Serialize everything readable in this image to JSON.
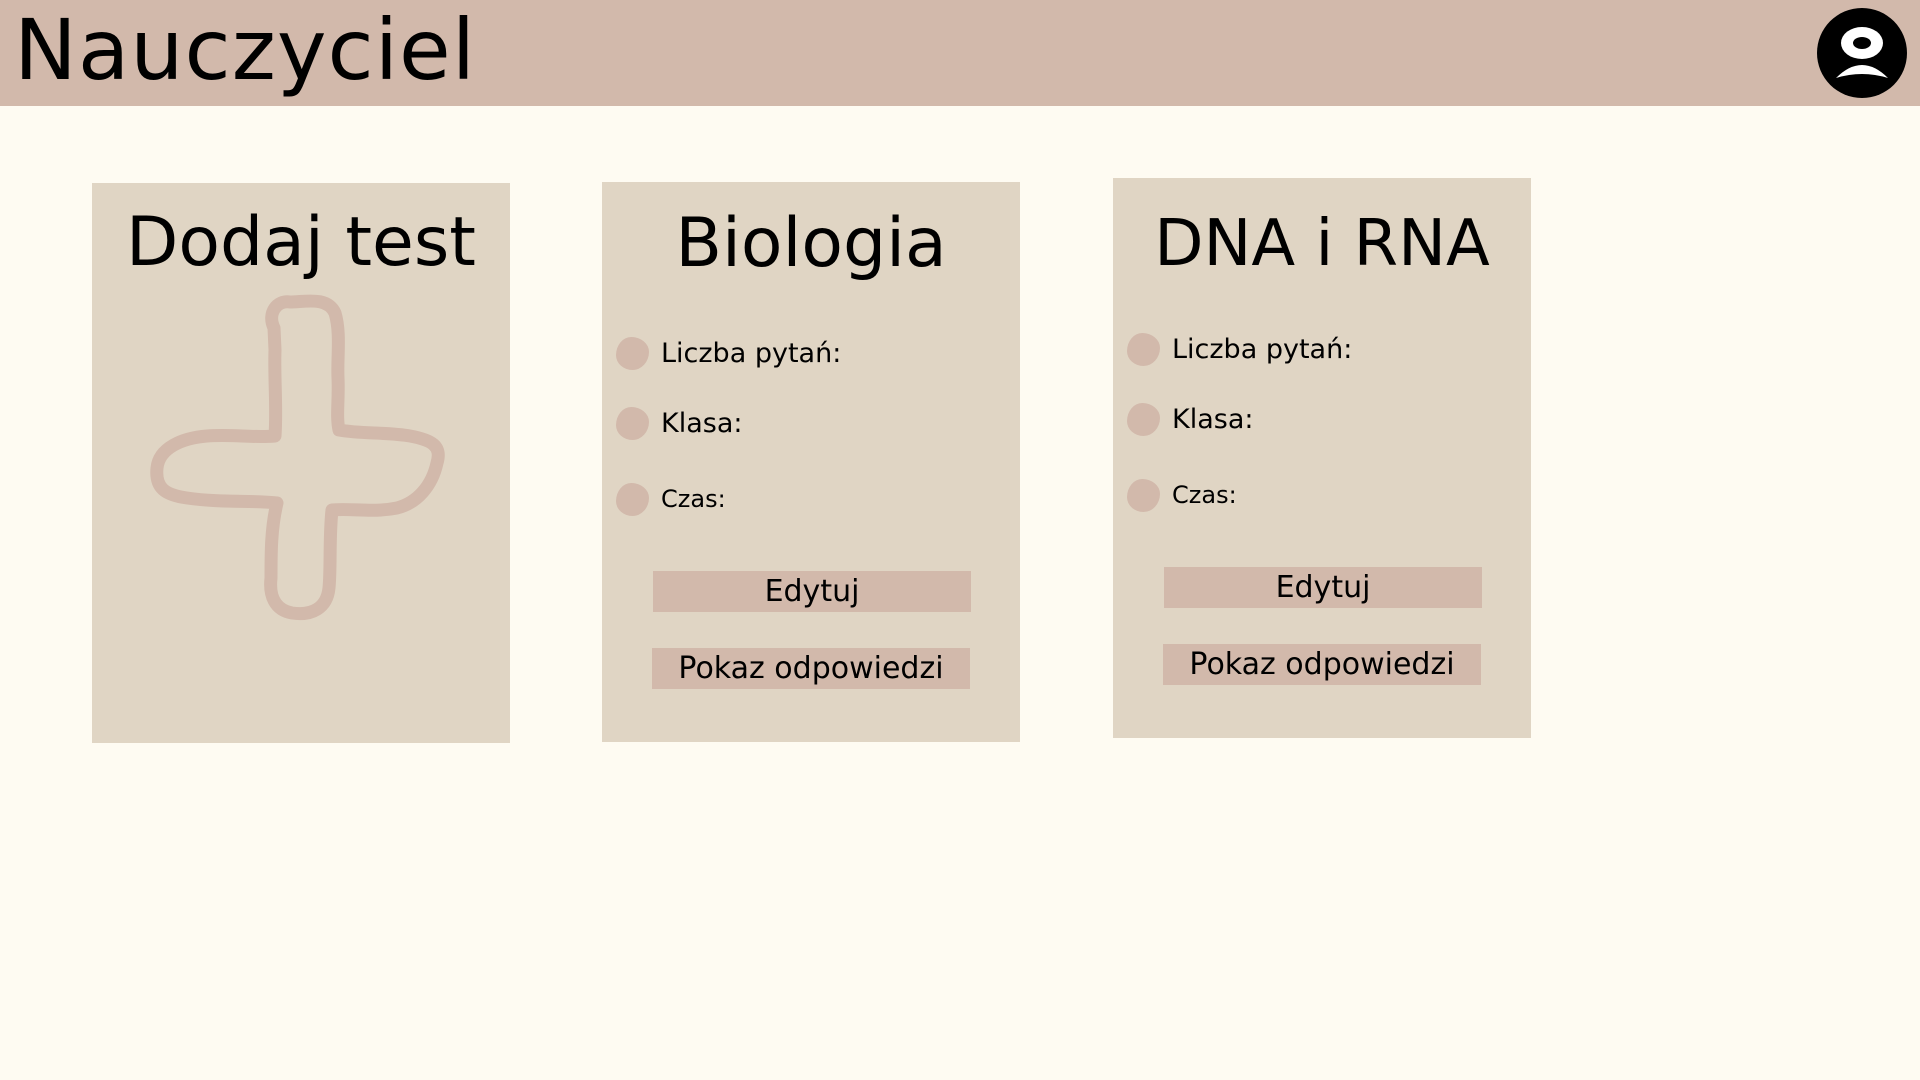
{
  "header": {
    "title": "Nauczyciel",
    "avatar_icon": "user-avatar-icon"
  },
  "add_card": {
    "label": "Dodaj test",
    "icon": "plus-icon"
  },
  "tests": [
    {
      "title": "Biologia",
      "fields": [
        {
          "label": "Liczba pytań:"
        },
        {
          "label": "Klasa:"
        },
        {
          "label": "Czas:"
        }
      ],
      "edit_label": "Edytuj",
      "answers_label": "Pokaz odpowiedzi"
    },
    {
      "title": "DNA i RNA",
      "fields": [
        {
          "label": "Liczba pytań:"
        },
        {
          "label": "Klasa:"
        },
        {
          "label": "Czas:"
        }
      ],
      "edit_label": "Edytuj",
      "answers_label": "Pokaz odpowiedzi"
    }
  ],
  "colors": {
    "background": "#fefbf2",
    "header": "#d2b9ab",
    "card": "#e0d5c4",
    "accent": "#d2b9ab",
    "text": "#000000"
  }
}
